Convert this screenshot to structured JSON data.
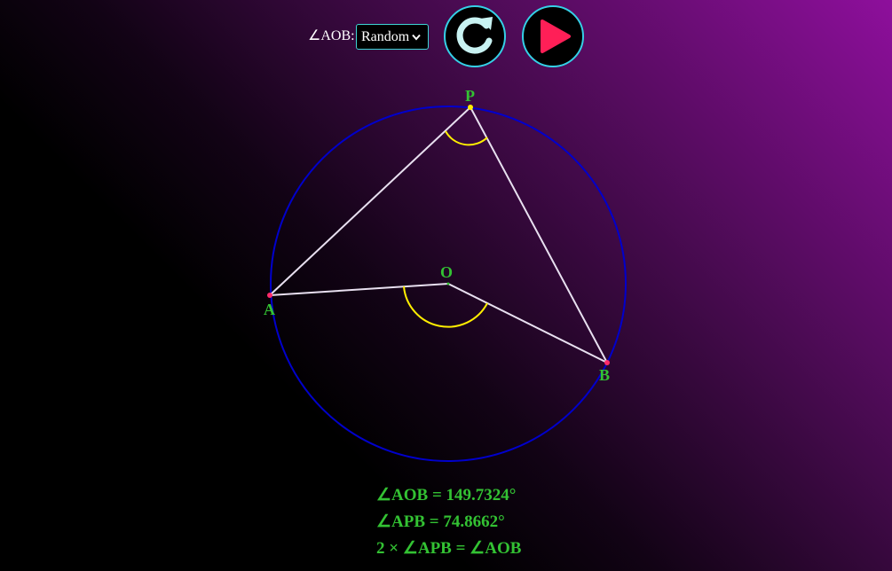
{
  "controls": {
    "angle_label": "∠AOB:",
    "mode_select": {
      "selected": "Random"
    }
  },
  "icons": {
    "reset": "refresh-icon",
    "play": "play-icon"
  },
  "colors": {
    "circle": "#0000cc",
    "chords": "#e8e0f0",
    "arcs": "#ffee00",
    "labels": "#33c233",
    "point_A": "#ff2a6a",
    "point_P": "#ffee00",
    "point_B": "#ff2a6a",
    "button_border": "#35d0e6",
    "refresh_icon": "#c8f2f2",
    "play_icon": "#ff1f57"
  },
  "diagram": {
    "points": {
      "P": "P",
      "O": "O",
      "A": "A",
      "B": "B"
    }
  },
  "readouts": {
    "aob": "∠AOB = 149.7324°",
    "apb": "∠APB = 74.8662°",
    "relation": "2 × ∠APB = ∠AOB"
  }
}
